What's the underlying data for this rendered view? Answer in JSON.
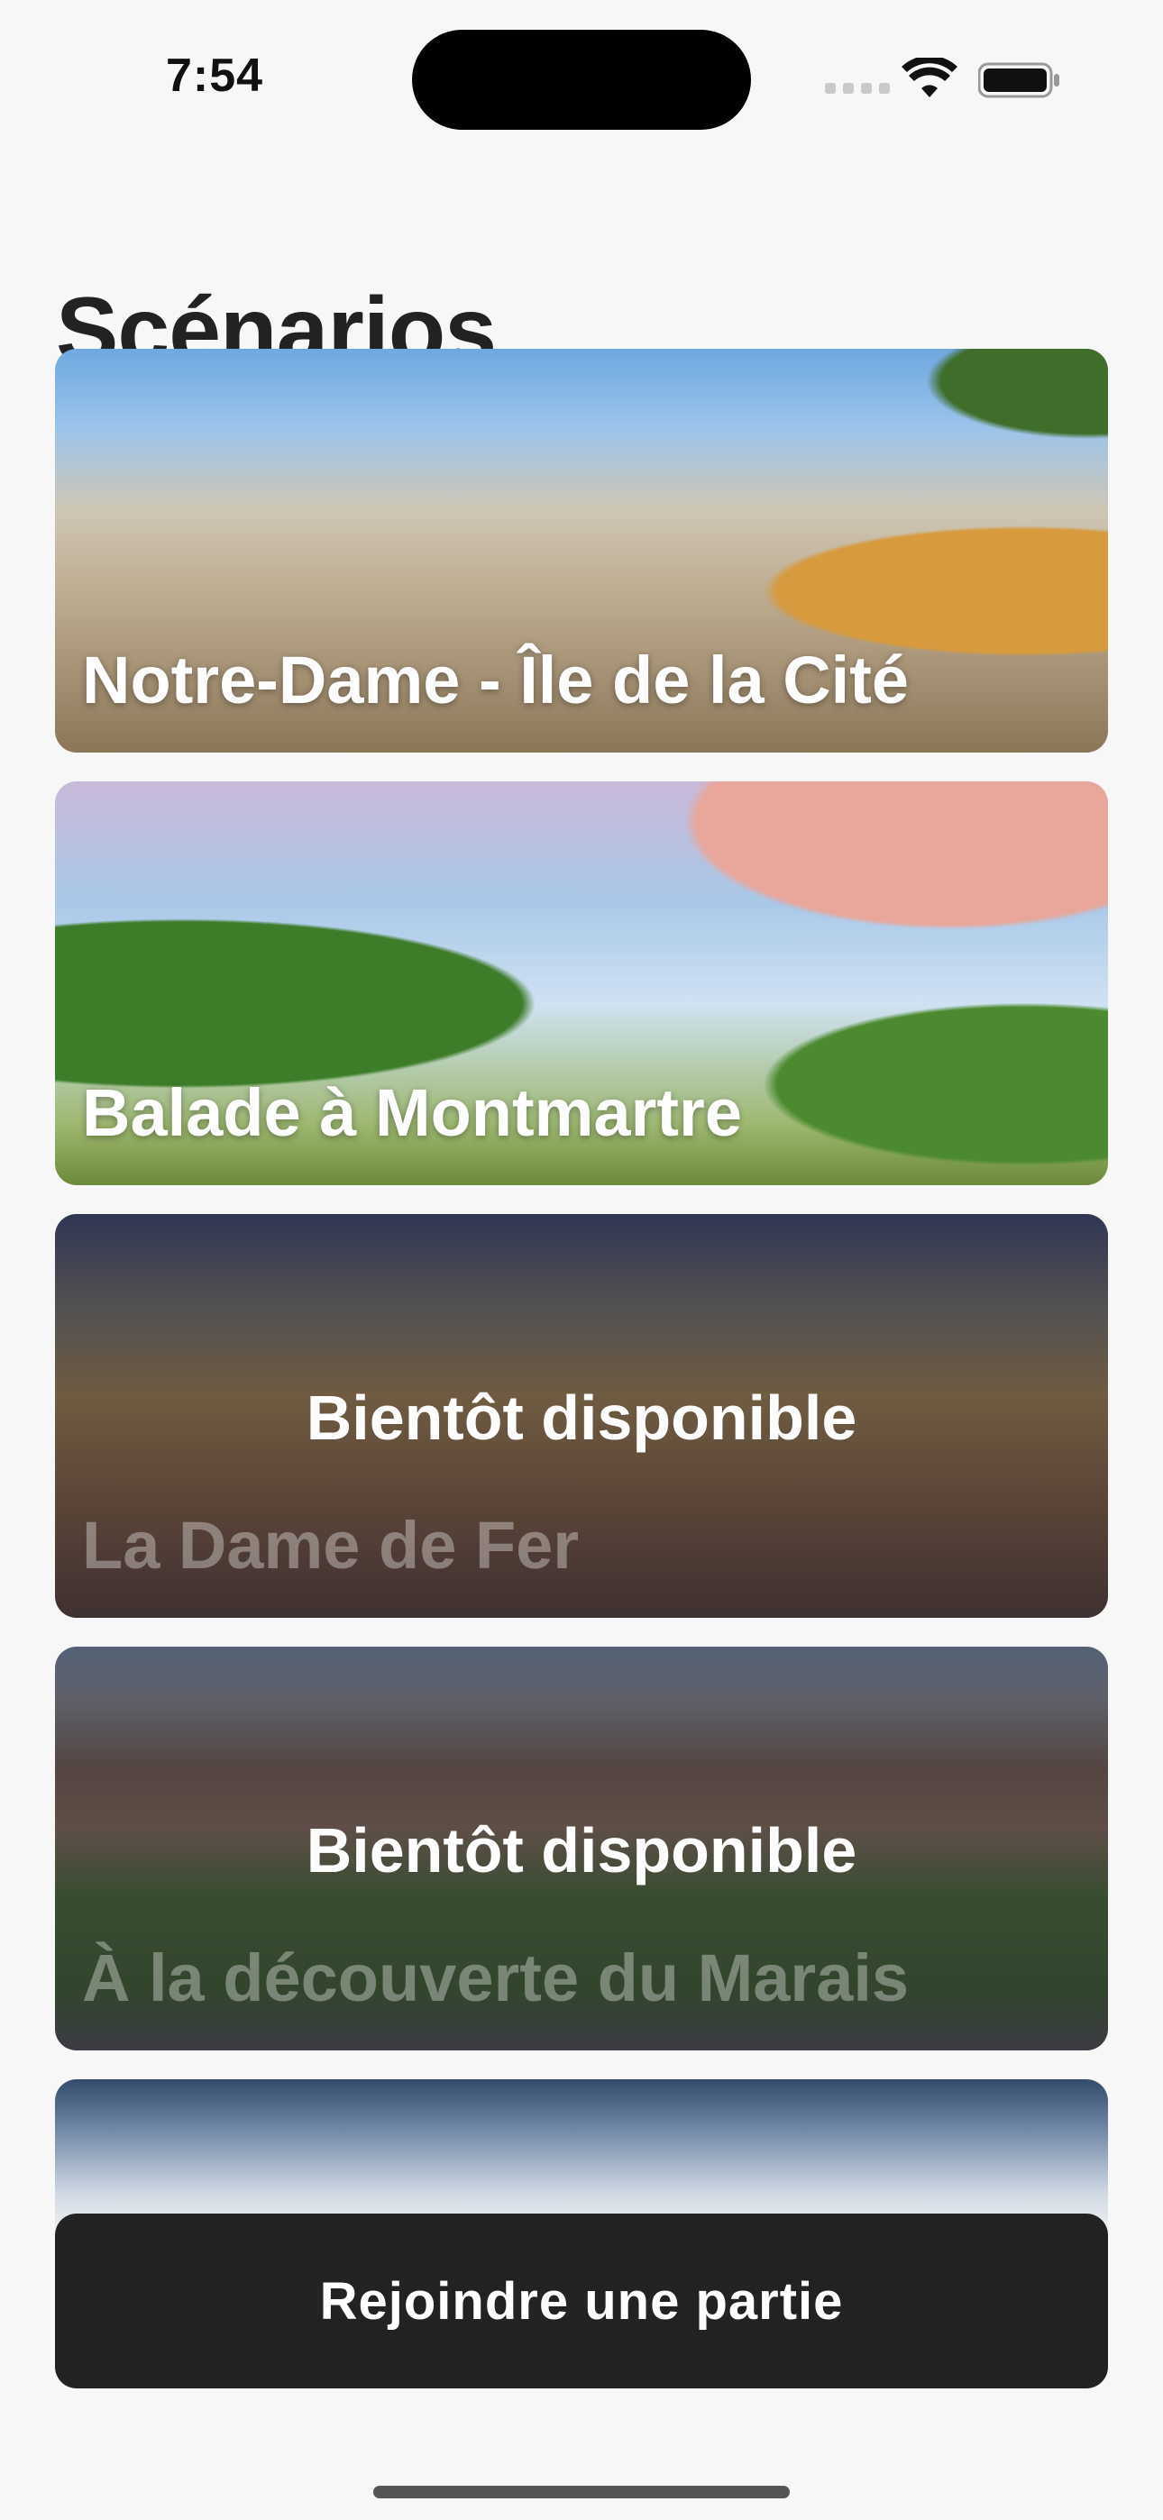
{
  "status_bar": {
    "time": "7:54",
    "icons": [
      "signal-icon",
      "wifi-icon",
      "battery-icon"
    ]
  },
  "header": {
    "title": "Scénarios"
  },
  "scenarios": [
    {
      "title": "Notre-Dame - Île de la Cité",
      "available": true
    },
    {
      "title": "Balade à Montmartre",
      "available": true
    },
    {
      "title": "La Dame de Fer",
      "available": false,
      "overlay": "Bientôt disponible"
    },
    {
      "title": "À la découverte du Marais",
      "available": false,
      "overlay": "Bientôt disponible"
    }
  ],
  "actions": {
    "join_label": "Rejoindre une partie"
  }
}
